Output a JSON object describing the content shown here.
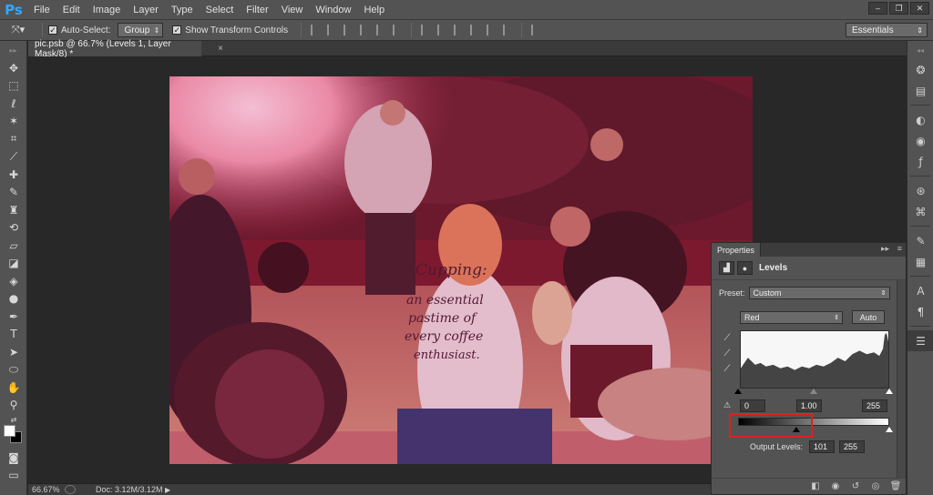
{
  "app": {
    "logo": "Ps"
  },
  "menu": [
    "File",
    "Edit",
    "Image",
    "Layer",
    "Type",
    "Select",
    "Filter",
    "View",
    "Window",
    "Help"
  ],
  "window_controls": {
    "minimize": "‒",
    "restore": "❐",
    "close": "✕"
  },
  "options_bar": {
    "auto_select_label": "Auto-Select:",
    "auto_select_checked": true,
    "auto_select_value": "Group",
    "transform_label": "Show Transform Controls",
    "transform_checked": true,
    "workspace": "Essentials"
  },
  "document_tab": {
    "title": "pic.psb @ 66.7% (Levels 1, Layer Mask/8) *",
    "close": "×"
  },
  "status_bar": {
    "zoom": "66.67%",
    "doc": "Doc: 3.12M/3.12M",
    "arrow": "▶"
  },
  "photo": {
    "shirt_text": [
      "Cupping:",
      "an essential",
      "pastime of",
      "every coffee",
      "enthusiast."
    ],
    "tint": "#c2185b"
  },
  "properties": {
    "panel_tab": "Properties",
    "collapse": "▸▸",
    "menu": "≡",
    "title": "Levels",
    "preset_label": "Preset:",
    "preset_value": "Custom",
    "channel_value": "Red",
    "auto_button": "Auto",
    "input_black": "0",
    "input_gamma": "1.00",
    "input_white": "255",
    "output_label": "Output Levels:",
    "output_black": "101",
    "output_white": "255"
  },
  "colors": {
    "highlight": "#e02020",
    "panel": "#535353",
    "canvas_bg": "#282828"
  }
}
